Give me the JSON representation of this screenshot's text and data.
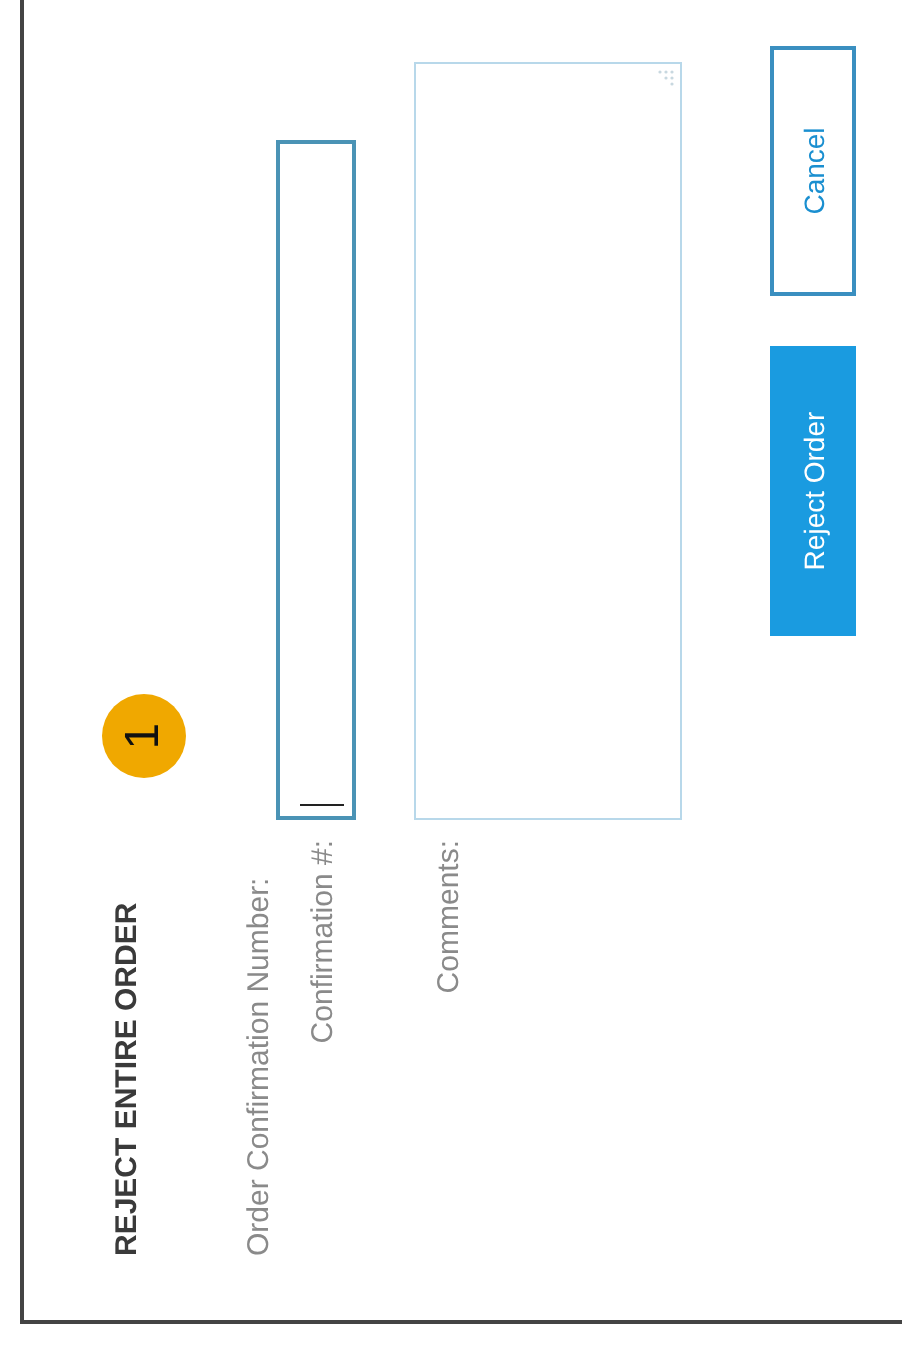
{
  "dialog": {
    "title": "REJECT ENTIRE ORDER",
    "step_badge": "1",
    "section_label": "Order Confirmation Number:",
    "fields": [
      {
        "kind": "input",
        "label": "Confirmation #:",
        "focused": true
      },
      {
        "kind": "textarea",
        "label": "Comments:",
        "focused": false
      }
    ],
    "buttons": [
      {
        "kind": "primary",
        "label": "Reject Order"
      },
      {
        "kind": "secondary",
        "label": "Cancel"
      }
    ]
  }
}
